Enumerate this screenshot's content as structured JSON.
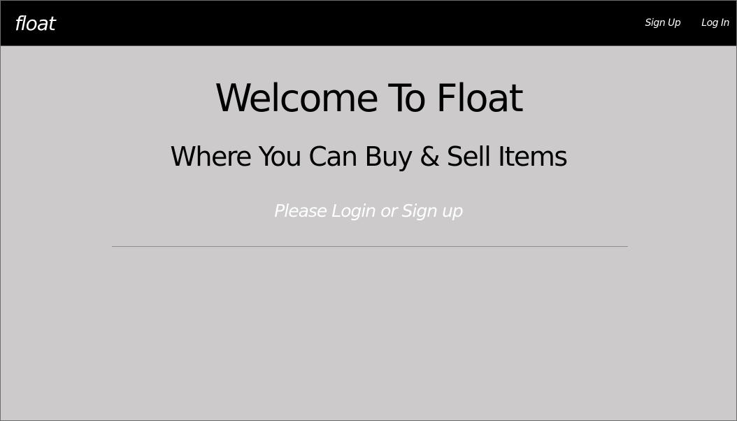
{
  "navbar": {
    "brand": "float",
    "links": [
      {
        "label": "Sign Up"
      },
      {
        "label": "Log In"
      }
    ],
    "background": "#000000"
  },
  "main": {
    "title": "Welcome To Float",
    "subtitle": "Where You Can Buy & Sell Items",
    "prompt": "Please Login or Sign up",
    "background": "#cccaca",
    "prompt_color": "#ffffff"
  }
}
